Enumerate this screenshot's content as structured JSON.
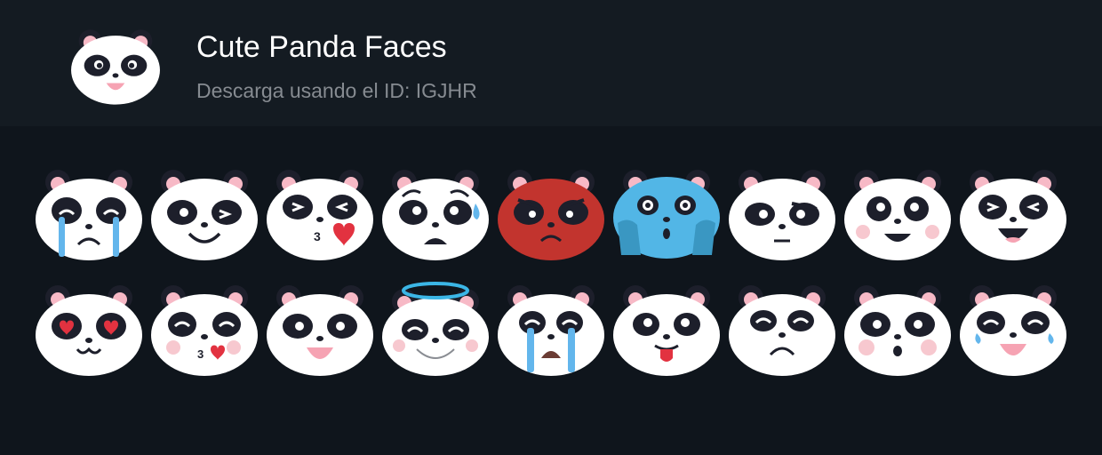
{
  "header": {
    "title": "Cute Panda Faces",
    "subtitle": "Descarga usando el ID: IGJHR"
  },
  "colors": {
    "background": "#0f151c",
    "header_background": "#141b22",
    "title": "#ffffff",
    "subtitle": "#868b91",
    "panda_face": "#ffffff",
    "panda_dark": "#1d1f2b",
    "ear_pink": "#f7b9c6",
    "angry_red": "#c2342e",
    "shocked_blue": "#52b6e6",
    "tear_blue": "#63b6ec",
    "heart_red": "#e23240",
    "halo_blue": "#3bb6e6"
  },
  "stickers": [
    {
      "name": "panda-crying-sad",
      "icon": "crying-sad-panda-icon"
    },
    {
      "name": "panda-happy-smile",
      "icon": "smiling-panda-icon"
    },
    {
      "name": "panda-blowing-kiss",
      "icon": "kissing-heart-panda-icon"
    },
    {
      "name": "panda-worried-sweat",
      "icon": "worried-sweating-panda-icon"
    },
    {
      "name": "panda-angry-red",
      "icon": "angry-red-panda-icon"
    },
    {
      "name": "panda-shocked-blue",
      "icon": "shocked-blue-panda-icon"
    },
    {
      "name": "panda-skeptical",
      "icon": "skeptical-panda-icon"
    },
    {
      "name": "panda-blushing-grin",
      "icon": "blushing-grin-panda-icon"
    },
    {
      "name": "panda-laughing",
      "icon": "laughing-panda-icon"
    },
    {
      "name": "panda-heart-eyes",
      "icon": "heart-eyes-panda-icon"
    },
    {
      "name": "panda-kiss-blush",
      "icon": "kiss-blush-panda-icon"
    },
    {
      "name": "panda-open-smile",
      "icon": "open-smile-panda-icon"
    },
    {
      "name": "panda-angel-halo",
      "icon": "angel-halo-panda-icon"
    },
    {
      "name": "panda-sobbing",
      "icon": "sobbing-panda-icon"
    },
    {
      "name": "panda-tongue-out",
      "icon": "tongue-out-panda-icon"
    },
    {
      "name": "panda-frowning",
      "icon": "frowning-panda-icon"
    },
    {
      "name": "panda-surprised",
      "icon": "surprised-panda-icon"
    },
    {
      "name": "panda-tears-of-joy",
      "icon": "tears-of-joy-panda-icon"
    }
  ]
}
